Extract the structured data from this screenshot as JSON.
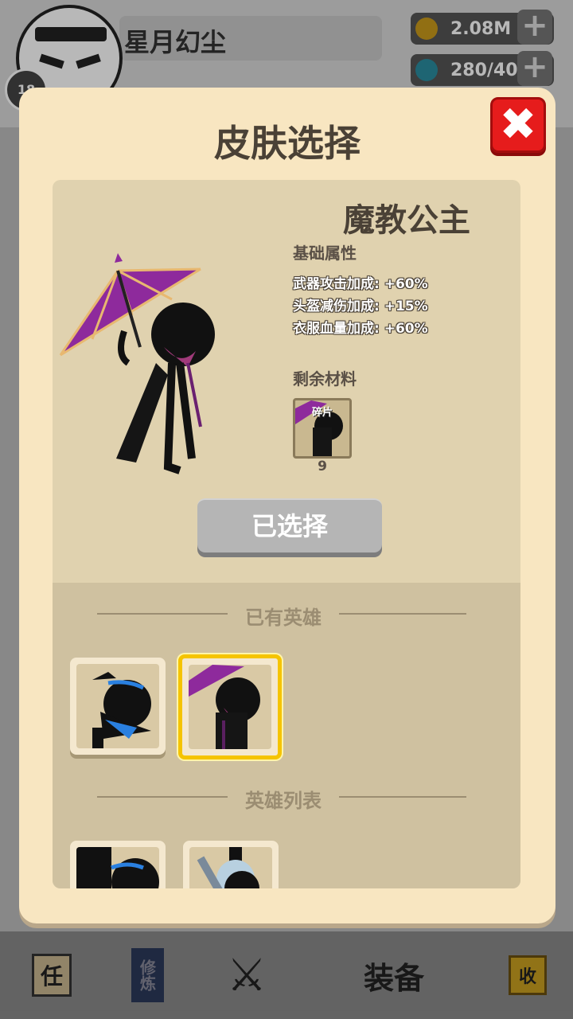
{
  "player": {
    "name": "星月幻尘",
    "level": "18"
  },
  "resources": {
    "gold": "2.08M",
    "gems": "280/40"
  },
  "nav": {
    "task": "任",
    "cultivate": "修炼",
    "equip": "装备",
    "collect": "收"
  },
  "dialog": {
    "title": "皮肤选择",
    "close_icon": "close-x-icon",
    "skin": {
      "name": "魔教公主",
      "base_attr_label": "基础属性",
      "stats": [
        "武器攻击加成: +60%",
        "头盔减伤加成: +15%",
        "衣服血量加成: +60%"
      ],
      "materials_label": "剩余材料",
      "fragment_label": "碎片",
      "fragment_count": "9",
      "select_button": "已选择"
    },
    "owned_label": "已有英雄",
    "list_label": "英雄列表"
  },
  "colors": {
    "dialog_bg": "#f8e6c1",
    "panel_bg": "#e0d2af",
    "selected_border": "#f5c400",
    "close_red": "#e61c1c",
    "umbrella_purple": "#8e2a9c"
  }
}
